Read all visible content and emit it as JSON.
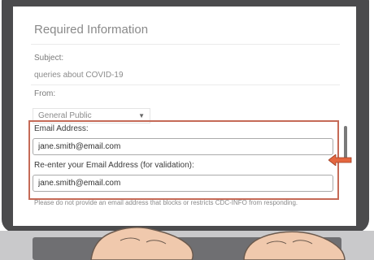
{
  "form": {
    "heading": "Required Information",
    "subject_label": "Subject:",
    "subject_value": "queries about COVID-19",
    "from_label": "From:",
    "from_value": "General Public",
    "email_label": "Email Address:",
    "email_value": "jane.smith@email.com",
    "reenter_label": "Re-enter your Email Address (for validation):",
    "reenter_value": "jane.smith@email.com",
    "note": "Please do not provide an email address that blocks or restricts CDC-INFO from responding."
  },
  "colors": {
    "highlight": "#c56a57",
    "arrow": "#e4663f",
    "bezel": "#4b4b4d",
    "skin": "#f0c9ad"
  },
  "icons": {
    "select_caret": "caret-down-icon",
    "pointer_arrow": "arrow-left-icon"
  }
}
